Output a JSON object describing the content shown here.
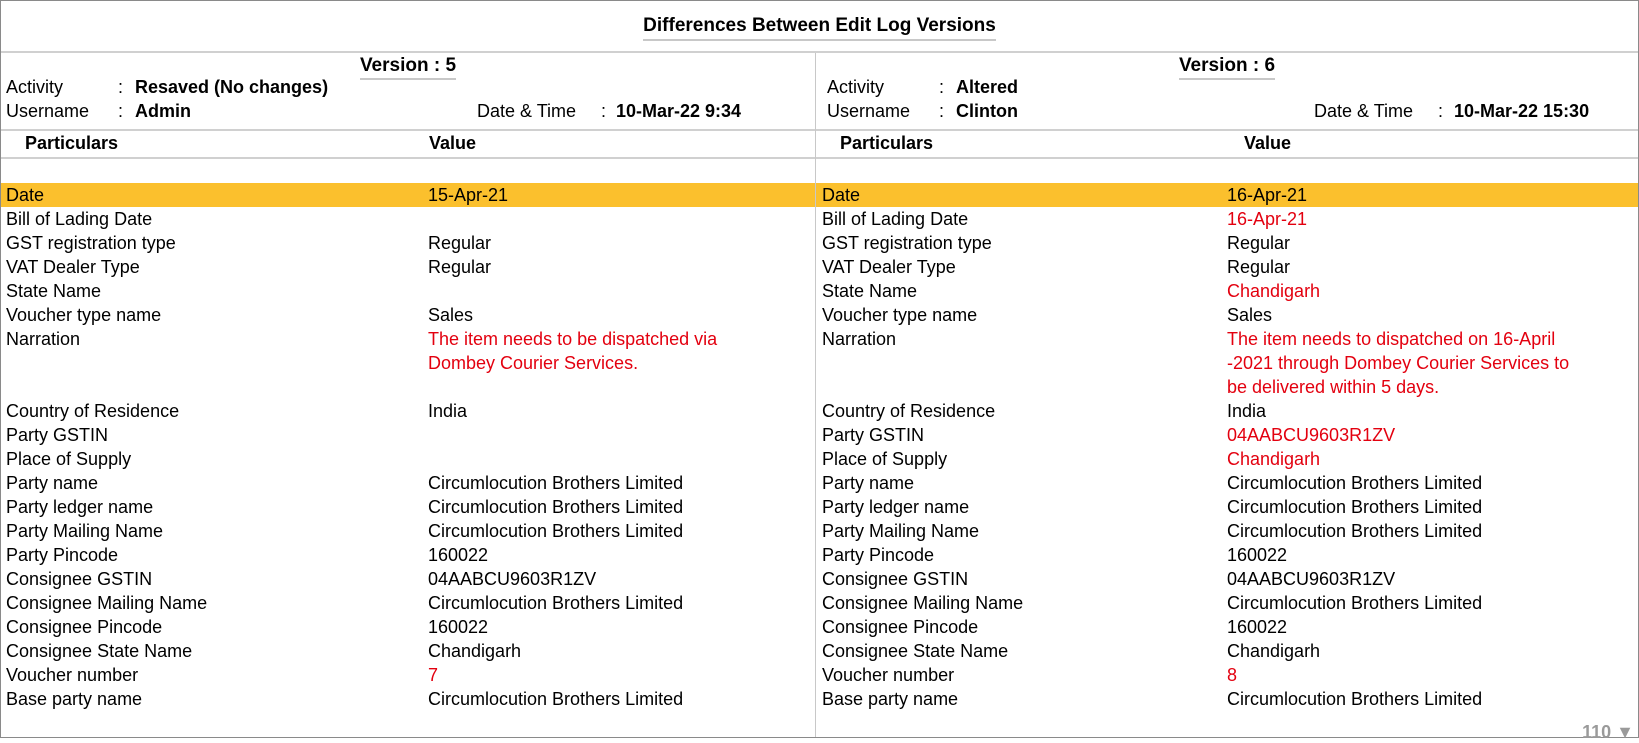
{
  "title": "Differences Between Edit Log Versions",
  "colors": {
    "highlight": "#fbc02d",
    "changed": "#e3000f"
  },
  "left": {
    "version_label": "Version : 5",
    "activity_label": "Activity",
    "activity": "Resaved (No changes)",
    "username_label": "Username",
    "username": "Admin",
    "datetime_label": "Date & Time",
    "datetime": "10-Mar-22 9:34",
    "col_particulars": "Particulars",
    "col_value": "Value",
    "rows": [
      {
        "p": "Date",
        "v": "15-Apr-21",
        "changed": false
      },
      {
        "p": "Bill of Lading Date",
        "v": "",
        "changed": false
      },
      {
        "p": "GST registration type",
        "v": "Regular",
        "changed": false
      },
      {
        "p": "VAT Dealer Type",
        "v": "Regular",
        "changed": false
      },
      {
        "p": "State Name",
        "v": "",
        "changed": false
      },
      {
        "p": "Voucher type name",
        "v": "Sales",
        "changed": false
      },
      {
        "p": "Narration",
        "v": "The item needs to be dispatched via Dombey Courier Services.",
        "changed": true
      },
      {
        "p": "Country of Residence",
        "v": "India",
        "changed": false
      },
      {
        "p": "Party GSTIN",
        "v": "",
        "changed": false
      },
      {
        "p": "Place of Supply",
        "v": "",
        "changed": false
      },
      {
        "p": "Party name",
        "v": "Circumlocution Brothers Limited",
        "changed": false
      },
      {
        "p": "Party ledger name",
        "v": "Circumlocution Brothers Limited",
        "changed": false
      },
      {
        "p": "Party Mailing Name",
        "v": "Circumlocution Brothers Limited",
        "changed": false
      },
      {
        "p": "Party Pincode",
        "v": "160022",
        "changed": false
      },
      {
        "p": "Consignee GSTIN",
        "v": "04AABCU9603R1ZV",
        "changed": false
      },
      {
        "p": "Consignee Mailing Name",
        "v": "Circumlocution Brothers Limited",
        "changed": false
      },
      {
        "p": "Consignee Pincode",
        "v": "160022",
        "changed": false
      },
      {
        "p": "Consignee State Name",
        "v": "Chandigarh",
        "changed": false
      },
      {
        "p": "Voucher number",
        "v": "7",
        "changed": true
      },
      {
        "p": "Base party name",
        "v": "Circumlocution Brothers Limited",
        "changed": false
      }
    ]
  },
  "right": {
    "version_label": "Version : 6",
    "activity_label": "Activity",
    "activity": "Altered",
    "username_label": "Username",
    "username": "Clinton",
    "datetime_label": "Date & Time",
    "datetime": "10-Mar-22 15:30",
    "col_particulars": "Particulars",
    "col_value": "Value",
    "rows": [
      {
        "p": "Date",
        "v": "16-Apr-21",
        "changed": false
      },
      {
        "p": "Bill of Lading Date",
        "v": "16-Apr-21",
        "changed": true
      },
      {
        "p": "GST registration type",
        "v": "Regular",
        "changed": false
      },
      {
        "p": "VAT Dealer Type",
        "v": "Regular",
        "changed": false
      },
      {
        "p": "State Name",
        "v": "Chandigarh",
        "changed": true
      },
      {
        "p": "Voucher type name",
        "v": "Sales",
        "changed": false
      },
      {
        "p": "Narration",
        "v": "The item needs to dispatched on 16-April -2021 through Dombey Courier Services to be delivered within 5 days.",
        "changed": true
      },
      {
        "p": "Country of Residence",
        "v": "India",
        "changed": false
      },
      {
        "p": "Party GSTIN",
        "v": "04AABCU9603R1ZV",
        "changed": true
      },
      {
        "p": "Place of Supply",
        "v": "Chandigarh",
        "changed": true
      },
      {
        "p": "Party name",
        "v": "Circumlocution Brothers Limited",
        "changed": false
      },
      {
        "p": "Party ledger name",
        "v": "Circumlocution Brothers Limited",
        "changed": false
      },
      {
        "p": "Party Mailing Name",
        "v": "Circumlocution Brothers Limited",
        "changed": false
      },
      {
        "p": "Party Pincode",
        "v": "160022",
        "changed": false
      },
      {
        "p": "Consignee GSTIN",
        "v": "04AABCU9603R1ZV",
        "changed": false
      },
      {
        "p": "Consignee Mailing Name",
        "v": "Circumlocution Brothers Limited",
        "changed": false
      },
      {
        "p": "Consignee Pincode",
        "v": "160022",
        "changed": false
      },
      {
        "p": "Consignee State Name",
        "v": "Chandigarh",
        "changed": false
      },
      {
        "p": "Voucher number",
        "v": "8",
        "changed": true
      },
      {
        "p": "Base party name",
        "v": "Circumlocution Brothers Limited",
        "changed": false
      }
    ]
  },
  "footer": {
    "count": "110",
    "scroll_icon": "triangle-down"
  }
}
